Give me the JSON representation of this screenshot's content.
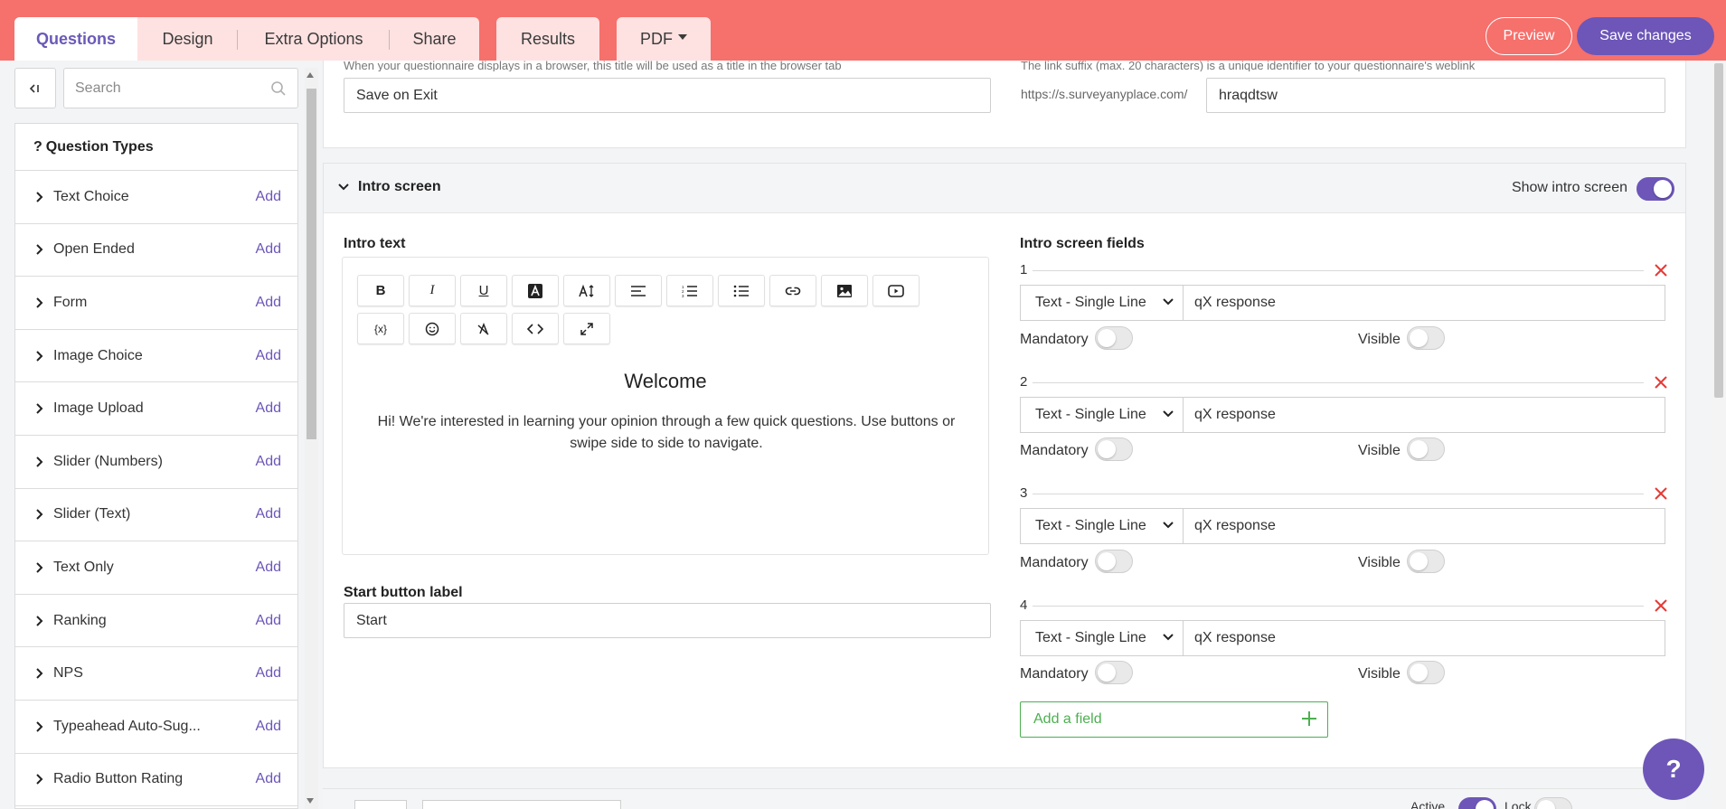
{
  "colors": {
    "topbar": "#f6706c",
    "accent": "#6d56b8",
    "success": "#4caf50",
    "danger": "#e53935"
  },
  "tabs": {
    "questions": "Questions",
    "design": "Design",
    "extra_options": "Extra Options",
    "share": "Share",
    "results": "Results",
    "pdf": "PDF"
  },
  "actions": {
    "preview": "Preview",
    "save": "Save changes"
  },
  "sidebar": {
    "collapse_icon": "collapse-left-icon",
    "search_placeholder": "Search",
    "panel_title": "Question Types",
    "add_label": "Add",
    "items": [
      {
        "label": "Text Choice"
      },
      {
        "label": "Open Ended"
      },
      {
        "label": "Form"
      },
      {
        "label": "Image Choice"
      },
      {
        "label": "Image Upload"
      },
      {
        "label": "Slider (Numbers)"
      },
      {
        "label": "Slider (Text)"
      },
      {
        "label": "Text Only"
      },
      {
        "label": "Ranking"
      },
      {
        "label": "NPS"
      },
      {
        "label": "Typeahead Auto-Sug..."
      },
      {
        "label": "Radio Button Rating"
      }
    ]
  },
  "settings": {
    "title_hint": "When your questionnaire displays in a browser, this title will be used as a title in the browser tab",
    "title_value": "Save on Exit",
    "link_hint": "The link suffix (max. 20 characters) is a unique identifier to your questionnaire's weblink",
    "link_prefix": "https://s.surveyanyplace.com/",
    "link_value": "hraqdtsw"
  },
  "intro": {
    "section_title": "Intro screen",
    "show_label": "Show intro screen",
    "show_enabled": true,
    "intro_text_label": "Intro text",
    "welcome": "Welcome",
    "body": "Hi! We're interested in learning your opinion through a few quick questions. Use buttons or swipe side to side to navigate.",
    "start_label_title": "Start button label",
    "start_value": "Start",
    "fields_title": "Intro screen fields",
    "mandatory_label": "Mandatory",
    "visible_label": "Visible",
    "add_field": "Add a field",
    "fields": [
      {
        "num": "1",
        "type": "Text - Single Line",
        "value": "qX response"
      },
      {
        "num": "2",
        "type": "Text - Single Line",
        "value": "qX response"
      },
      {
        "num": "3",
        "type": "Text - Single Line",
        "value": "qX response"
      },
      {
        "num": "4",
        "type": "Text - Single Line",
        "value": "qX response"
      }
    ]
  },
  "next_section": {
    "active_label": "Active",
    "lock_label": "Lock"
  },
  "help": {
    "label": "?"
  }
}
